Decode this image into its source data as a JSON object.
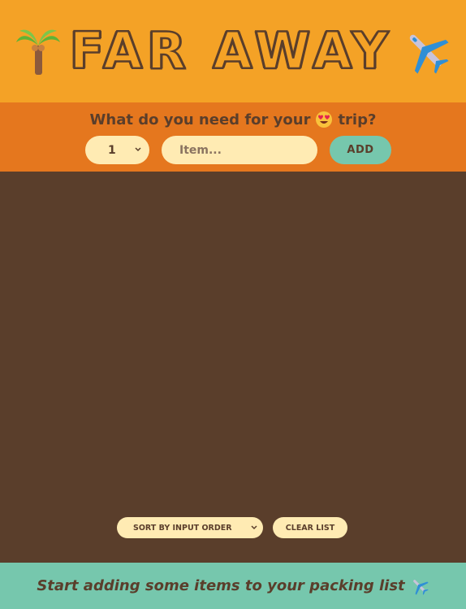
{
  "header": {
    "logo_left_icon": "palm-tree-icon",
    "logo_text": "FAR AWAY",
    "logo_right_icon": "airplane-icon"
  },
  "form": {
    "question_before": "What do you need for your",
    "question_emoji": "heart-eyes-face-icon",
    "question_after": "trip?",
    "quantity_value": "1",
    "item_placeholder": "Item...",
    "add_label": "ADD"
  },
  "list": {
    "sort_value": "SORT BY INPUT ORDER",
    "clear_label": "CLEAR LIST"
  },
  "footer": {
    "text": "Start adding some items to your packing list",
    "icon": "airplane-icon"
  },
  "colors": {
    "header_bg": "#f4a226",
    "form_bg": "#e5771e",
    "list_bg": "#5a3e2b",
    "footer_bg": "#76c7ad",
    "input_bg": "#ffebb3",
    "text_brown": "#5a3e2b"
  }
}
